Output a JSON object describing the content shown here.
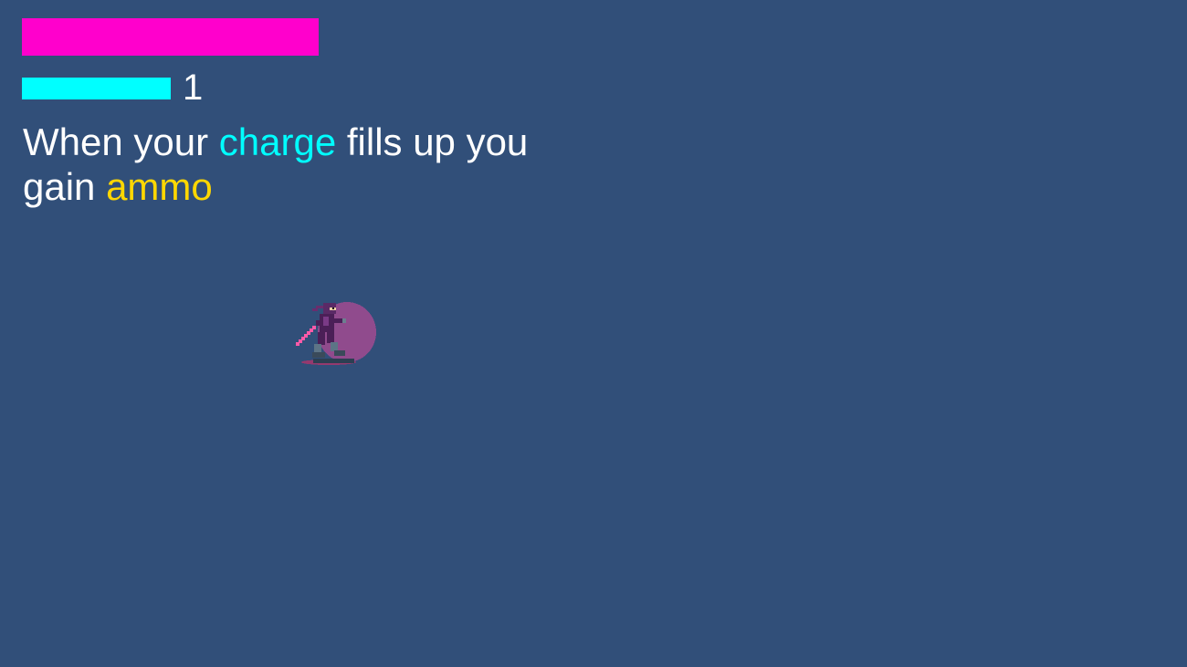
{
  "hud": {
    "health": {
      "fraction": 1.0,
      "color": "#ff00cc"
    },
    "charge": {
      "fraction": 1.0,
      "color": "#00ffff"
    },
    "ammo_count": "1"
  },
  "tutorial": {
    "part1": "When your ",
    "charge_word": "charge",
    "part2": " fills up you gain ",
    "ammo_word": "ammo",
    "text_color": "#ffffff",
    "charge_color": "#00ffff",
    "ammo_color": "#ffd700"
  },
  "scene": {
    "background_color": "#314f79"
  },
  "player": {
    "icon": "ninja-character-icon",
    "aura_color": "#9b4a8f"
  }
}
